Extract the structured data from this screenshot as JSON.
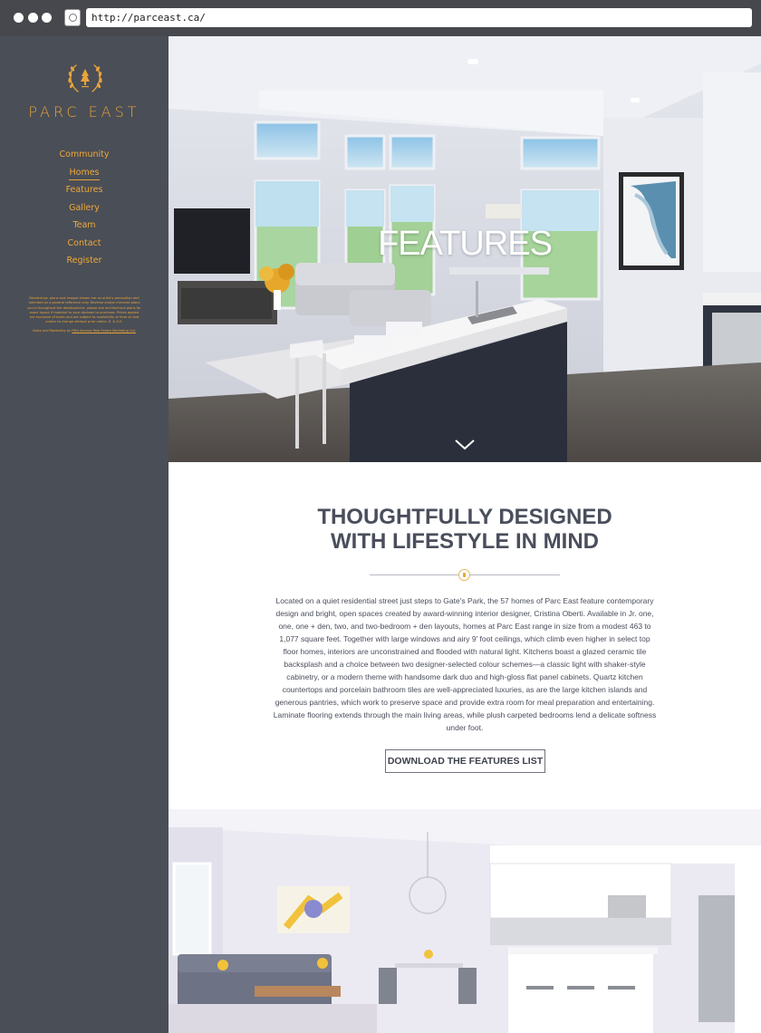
{
  "browser": {
    "url": "http://parceast.ca/"
  },
  "sidebar": {
    "logo_text": "PARC EAST",
    "nav": [
      {
        "label": "Community",
        "active": false
      },
      {
        "label": "Homes",
        "active": true
      },
      {
        "label": "Features",
        "active": false
      },
      {
        "label": "Gallery",
        "active": false
      },
      {
        "label": "Team",
        "active": false
      },
      {
        "label": "Contact",
        "active": false
      },
      {
        "label": "Register",
        "active": false
      }
    ],
    "disclaimer": "Renderings, plans and images shown are an artist's perception and intended as a general reference only. Reverse and/or mirrored plans occur throughout the development, please see architectural plans for exact layout if material to your decision to purchase. Prices quoted are exclusive of taxes and are subject to availability at time of visit and/or to change without prior notice. E. & O.E.",
    "marketing_prefix": "Sales and Marketing by",
    "marketing_link": "Fifth Avenue Real Estate Marketing Ltd."
  },
  "hero": {
    "title": "FEATURES"
  },
  "content": {
    "heading_line1": "THOUGHTFULLY DESIGNED",
    "heading_line2": "WITH LIFESTYLE IN MIND",
    "paragraph": "Located on a quiet residential street just steps to Gate's Park, the 57 homes of Parc East feature contemporary design and bright, open spaces created by award-winning interior designer, Cristina Oberti. Available in Jr. one, one, one + den, two, and two-bedroom + den layouts, homes at Parc East range in size from a modest 463 to 1,077 square feet. Together with large windows and airy 9' foot ceilings, which climb even higher in select top floor homes, interiors are unconstrained and flooded with natural light. Kitchens boast a glazed ceramic tile backsplash and a choice between two designer-selected colour schemes—a classic light with shaker-style cabinetry, or a modern theme with handsome dark duo and high-gloss flat panel cabinets. Quartz kitchen countertops and porcelain bathroom tiles are well-appreciated luxuries, as are the large kitchen islands and generous pantries, which work to preserve space and provide extra room for meal preparation and entertaining. Laminate flooring extends through the main living areas, while plush carpeted bedrooms lend a delicate softness under foot.",
    "button_label": "DOWNLOAD THE FEATURES LIST"
  },
  "colors": {
    "sidebar_bg": "#4a4e56",
    "accent": "#e8a33a",
    "heading": "#4a4e5c"
  }
}
